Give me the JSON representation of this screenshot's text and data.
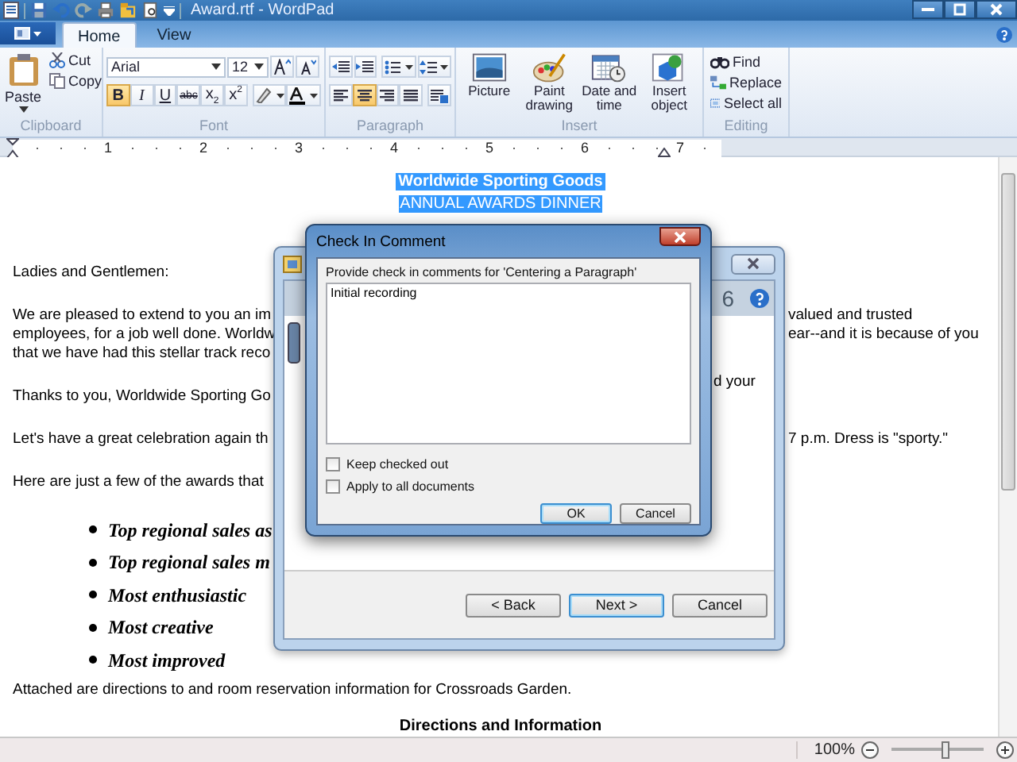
{
  "window": {
    "title": "Award.rtf - WordPad"
  },
  "tabs": [
    {
      "label": "Home",
      "selected": true
    },
    {
      "label": "View",
      "selected": false
    }
  ],
  "ribbon": {
    "clipboard": {
      "label": "Clipboard",
      "paste": "Paste",
      "cut": "Cut",
      "copy": "Copy"
    },
    "font": {
      "label": "Font",
      "name": "Arial",
      "size": "12",
      "styles": [
        {
          "kind": "bold",
          "label": "B",
          "selected": true
        },
        {
          "kind": "italic",
          "label": "I",
          "selected": false
        },
        {
          "kind": "underline",
          "label": "U",
          "selected": false
        },
        {
          "kind": "strike",
          "label": "abc",
          "selected": false
        },
        {
          "kind": "sub",
          "label": "x$_{2}$",
          "selected": false
        },
        {
          "kind": "sup",
          "label": "x$^{2}$",
          "selected": false
        }
      ]
    },
    "paragraph": {
      "label": "Paragraph",
      "alignment": [
        {
          "kind": "left",
          "selected": false
        },
        {
          "kind": "center",
          "selected": true
        },
        {
          "kind": "right",
          "selected": false
        },
        {
          "kind": "justify",
          "selected": false
        }
      ]
    },
    "insert": {
      "label": "Insert",
      "items": [
        {
          "kind": "picture",
          "label": "Picture"
        },
        {
          "kind": "paint",
          "label": "Paint drawing"
        },
        {
          "kind": "datetime",
          "label": "Date and time"
        },
        {
          "kind": "object",
          "label": "Insert object"
        }
      ]
    },
    "editing": {
      "label": "Editing",
      "items": [
        {
          "kind": "find",
          "label": "Find"
        },
        {
          "kind": "replace",
          "label": "Replace"
        },
        {
          "kind": "selectall",
          "label": "Select all"
        }
      ]
    }
  },
  "ruler": {
    "marks": [
      "1",
      "2",
      "3",
      "4",
      "5",
      "6",
      "7"
    ]
  },
  "document": {
    "title": {
      "text": "Worldwide Sporting Goods",
      "selected": true
    },
    "subtitle": "ANNUAL AWARDS DINNER",
    "blocks": [
      {
        "kind": "para",
        "lines": [
          {
            "left": "Ladies and Gentlemen:"
          }
        ]
      },
      {
        "kind": "para",
        "lines": [
          {
            "left": "We are pleased to extend to you an im",
            "right": "valued and trusted"
          },
          {
            "left": "employees, for a job well done.  Worldw",
            "right": "ear--and it is because of you"
          },
          {
            "left": "that we have had this stellar track reco"
          }
        ]
      },
      {
        "kind": "para",
        "lines": [
          {
            "left": "Thanks to you, Worldwide Sporting Go"
          }
        ]
      },
      {
        "kind": "para",
        "lines": [
          {
            "left": "Let's have a great celebration again th",
            "right": "7 p.m. Dress is \"sporty.\""
          }
        ]
      },
      {
        "kind": "para",
        "lines": [
          {
            "left": "Here are just a few of the awards that"
          }
        ]
      },
      {
        "kind": "bullet",
        "text": "Top regional sales as"
      },
      {
        "kind": "bullet",
        "text": "Top regional sales m"
      },
      {
        "kind": "bullet",
        "text": "Most enthusiastic"
      },
      {
        "kind": "bullet",
        "text": "Most creative"
      },
      {
        "kind": "bullet",
        "text": "Most improved"
      },
      {
        "kind": "para",
        "lines": [
          {
            "left": "Attached are directions to and room reservation information for Crossroads Garden."
          }
        ]
      },
      {
        "kind": "heading",
        "text": "Directions and Information"
      }
    ]
  },
  "wizard": {
    "header": "6",
    "body_text": "d your",
    "buttons": [
      {
        "label": "< Back",
        "default": false
      },
      {
        "label": "Next >",
        "default": true
      },
      {
        "label": "Cancel",
        "default": false
      }
    ]
  },
  "check_in": {
    "title": "Check In Comment",
    "prompt": "Provide check in comments for 'Centering a Paragraph'",
    "comment": "Initial recording",
    "options": [
      {
        "label": "Keep checked out",
        "checked": false
      },
      {
        "label": "Apply to all documents",
        "checked": false
      }
    ],
    "buttons": [
      {
        "label": "OK",
        "default": true
      },
      {
        "label": "Cancel",
        "default": false
      }
    ]
  },
  "status_bar": {
    "zoom": "100%",
    "zoom_slider": {
      "level": 0.6
    }
  }
}
